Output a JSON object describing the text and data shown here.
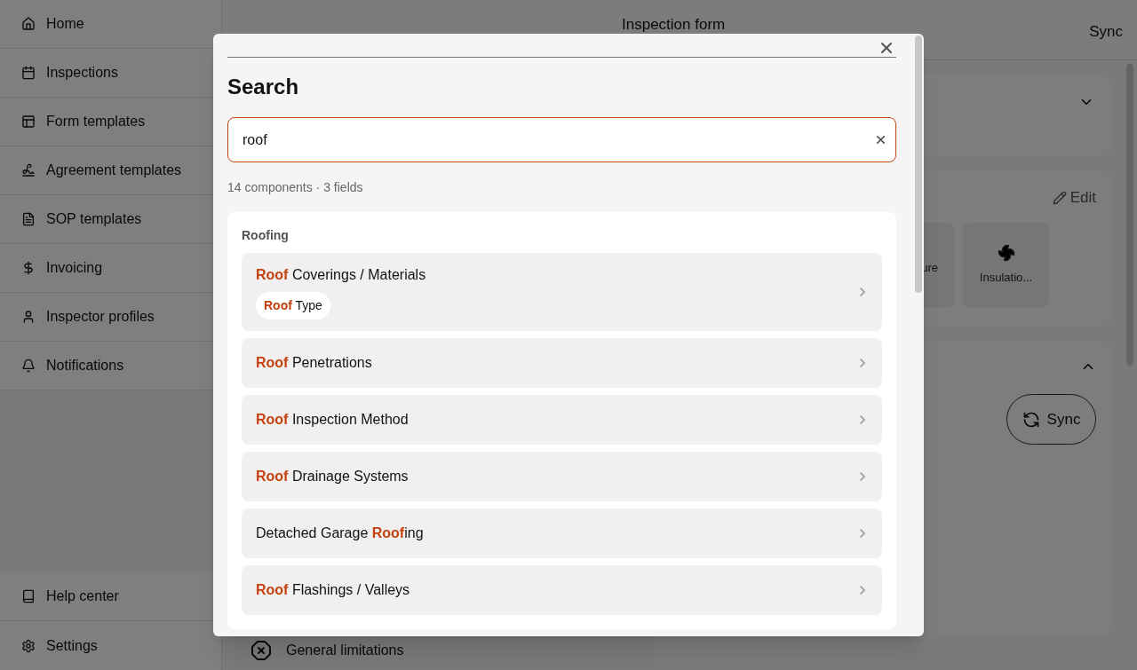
{
  "sidebar": {
    "items": [
      {
        "label": "Home"
      },
      {
        "label": "Inspections"
      },
      {
        "label": "Form templates"
      },
      {
        "label": "Agreement templates"
      },
      {
        "label": "SOP templates"
      },
      {
        "label": "Invoicing"
      },
      {
        "label": "Inspector profiles"
      },
      {
        "label": "Notifications"
      }
    ],
    "footer_items": [
      {
        "label": "Help center"
      },
      {
        "label": "Settings"
      }
    ]
  },
  "header": {
    "title": "Inspection form",
    "action": "Sync"
  },
  "right_cards": [
    {
      "kind": "collapsible",
      "expanded": false
    },
    {
      "kind": "tiles",
      "edit": "Edit",
      "tiles": [
        "ure",
        "Insulatio..."
      ]
    },
    {
      "kind": "sync",
      "expanded": true,
      "button": "Sync"
    }
  ],
  "left_items": [
    {
      "label": "General limitations"
    }
  ],
  "search_dialog": {
    "title": "Search",
    "query": "roof",
    "summary": "14 components · 3 fields",
    "groups": [
      {
        "label": "Roofing",
        "results": [
          {
            "segments": [
              {
                "text": "Roof",
                "match": true
              },
              {
                "text": " Coverings / Materials",
                "match": false
              }
            ],
            "fields": [
              {
                "segments": [
                  {
                    "text": "Roof",
                    "match": true
                  },
                  {
                    "text": " Type",
                    "match": false
                  }
                ]
              }
            ]
          },
          {
            "segments": [
              {
                "text": "Roof",
                "match": true
              },
              {
                "text": " Penetrations",
                "match": false
              }
            ]
          },
          {
            "segments": [
              {
                "text": "Roof",
                "match": true
              },
              {
                "text": " Inspection Method",
                "match": false
              }
            ]
          },
          {
            "segments": [
              {
                "text": "Roof",
                "match": true
              },
              {
                "text": " Drainage Systems",
                "match": false
              }
            ]
          },
          {
            "segments": [
              {
                "text": "Detached Garage ",
                "match": false
              },
              {
                "text": "Roof",
                "match": true
              },
              {
                "text": "ing",
                "match": false
              }
            ]
          },
          {
            "segments": [
              {
                "text": "Roof",
                "match": true
              },
              {
                "text": " Flashings / Valleys",
                "match": false
              }
            ]
          }
        ]
      }
    ]
  }
}
